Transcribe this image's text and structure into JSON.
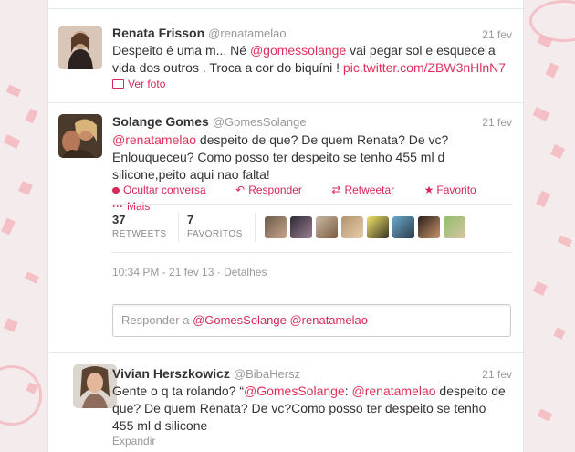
{
  "tweet1": {
    "name": "Renata Frisson",
    "handle": "@renatamelao",
    "time": "21 fev",
    "text_a": "Despeito é uma m... Né ",
    "mention": "@gomessolange",
    "text_b": " vai pegar sol e esquece  a",
    "text_c": "vida dos outros . Troca a cor do biquíni ! ",
    "pic_link": "pic.twitter.com/ZBW3nHlnN7",
    "view_photo": "Ver foto"
  },
  "tweet2": {
    "name": "Solange Gomes",
    "handle": "@GomesSolange",
    "time": "21 fev",
    "mention": "@renatamelao",
    "text_a": " despeito de que? De quem Renata? De vc?",
    "text_b": "Enlouqueceu? Como posso ter despeito se tenho 455 ml d",
    "text_c": "silicone,peito aqui nao falta!",
    "actions": {
      "hide": "Ocultar conversa",
      "reply": "Responder",
      "retweet": "Retweetar",
      "favorite": "Favorito",
      "more": "Mais"
    },
    "stats": {
      "retweets_count": "37",
      "retweets_label": "RETWEETS",
      "favorites_count": "7",
      "favorites_label": "FAVORITOS"
    },
    "timestamp": "10:34 PM - 21 fev 13",
    "details_sep": " · ",
    "details": "Detalhes"
  },
  "reply_box": {
    "placeholder_a": "Responder a ",
    "placeholder_mentions": "@GomesSolange @renatamelao"
  },
  "tweet3": {
    "name": "Vivian Herszkowicz",
    "handle": "@BibaHersz",
    "time": "21 fev",
    "text_a": "Gente o q ta rolando? “",
    "mention_a": "@GomesSolange",
    "colon": ": ",
    "mention_b": "@renatamelao",
    "text_b": " despeito de",
    "text_c": "que? De quem Renata? De vc?Como posso ter despeito se tenho",
    "text_d": "455 ml d silicone",
    "expand": "Expandir"
  },
  "colors": {
    "link": "#e0305a",
    "action": "#d6285a",
    "background_pattern": "#f3b7be"
  }
}
